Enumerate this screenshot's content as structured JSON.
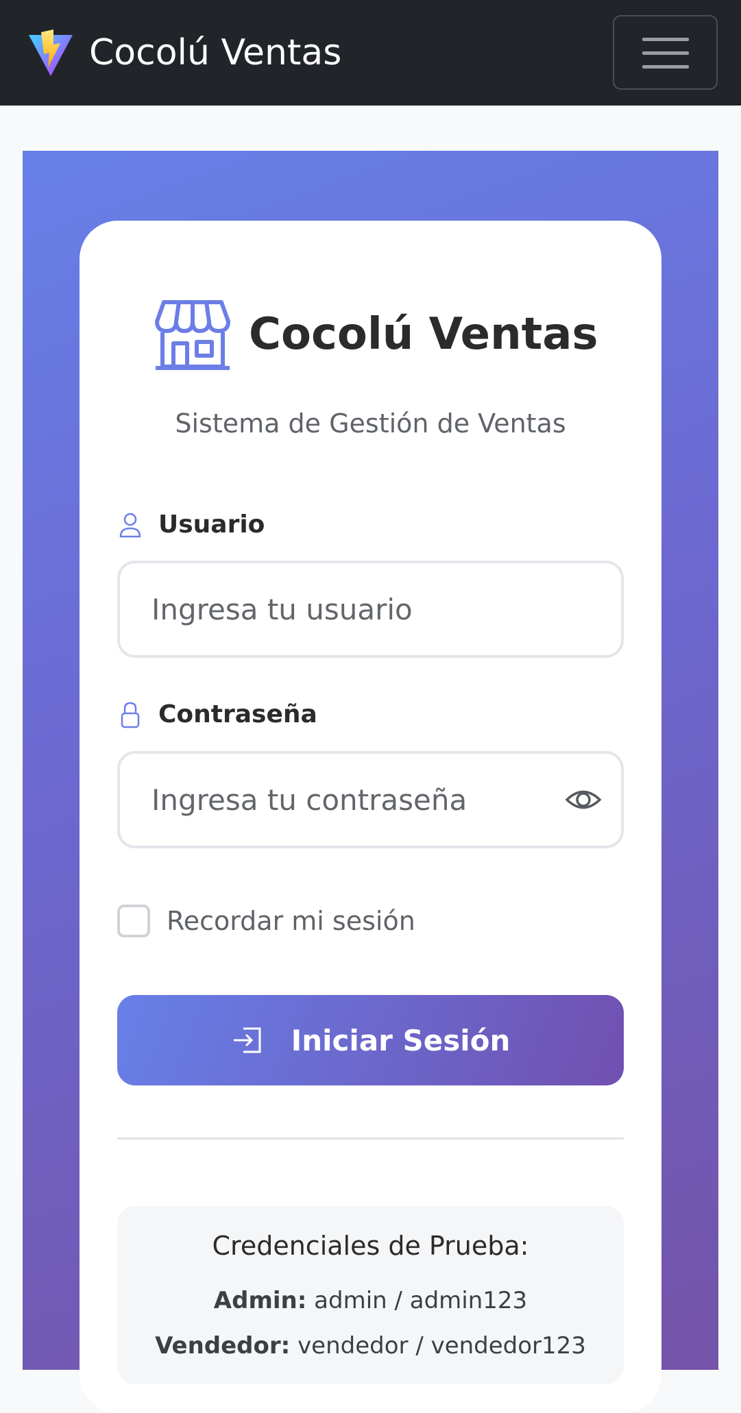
{
  "navbar": {
    "brand_text": "Cocolú Ventas",
    "logo_icon": "vite-bolt-icon",
    "menu_icon": "hamburger-menu-icon"
  },
  "login": {
    "title": "Cocolú Ventas",
    "title_icon": "store-icon",
    "subtitle": "Sistema de Gestión de Ventas",
    "username": {
      "label": "Usuario",
      "icon": "person-icon",
      "placeholder": "Ingresa tu usuario",
      "value": ""
    },
    "password": {
      "label": "Contraseña",
      "icon": "lock-icon",
      "placeholder": "Ingresa tu contraseña",
      "value": "",
      "toggle_icon": "eye-icon"
    },
    "remember_label": "Recordar mi sesión",
    "remember_checked": false,
    "submit_label": "Iniciar Sesión",
    "submit_icon": "box-arrow-in-right-icon"
  },
  "test_credentials": {
    "title": "Credenciales de Prueba:",
    "items": [
      {
        "role": "Admin:",
        "value": "admin / admin123"
      },
      {
        "role": "Vendedor:",
        "value": "vendedor / vendedor123"
      }
    ]
  },
  "colors": {
    "navbar_bg": "#212529",
    "gradient_start": "#6780e8",
    "gradient_end": "#7453a8",
    "accent": "#6780e8"
  }
}
